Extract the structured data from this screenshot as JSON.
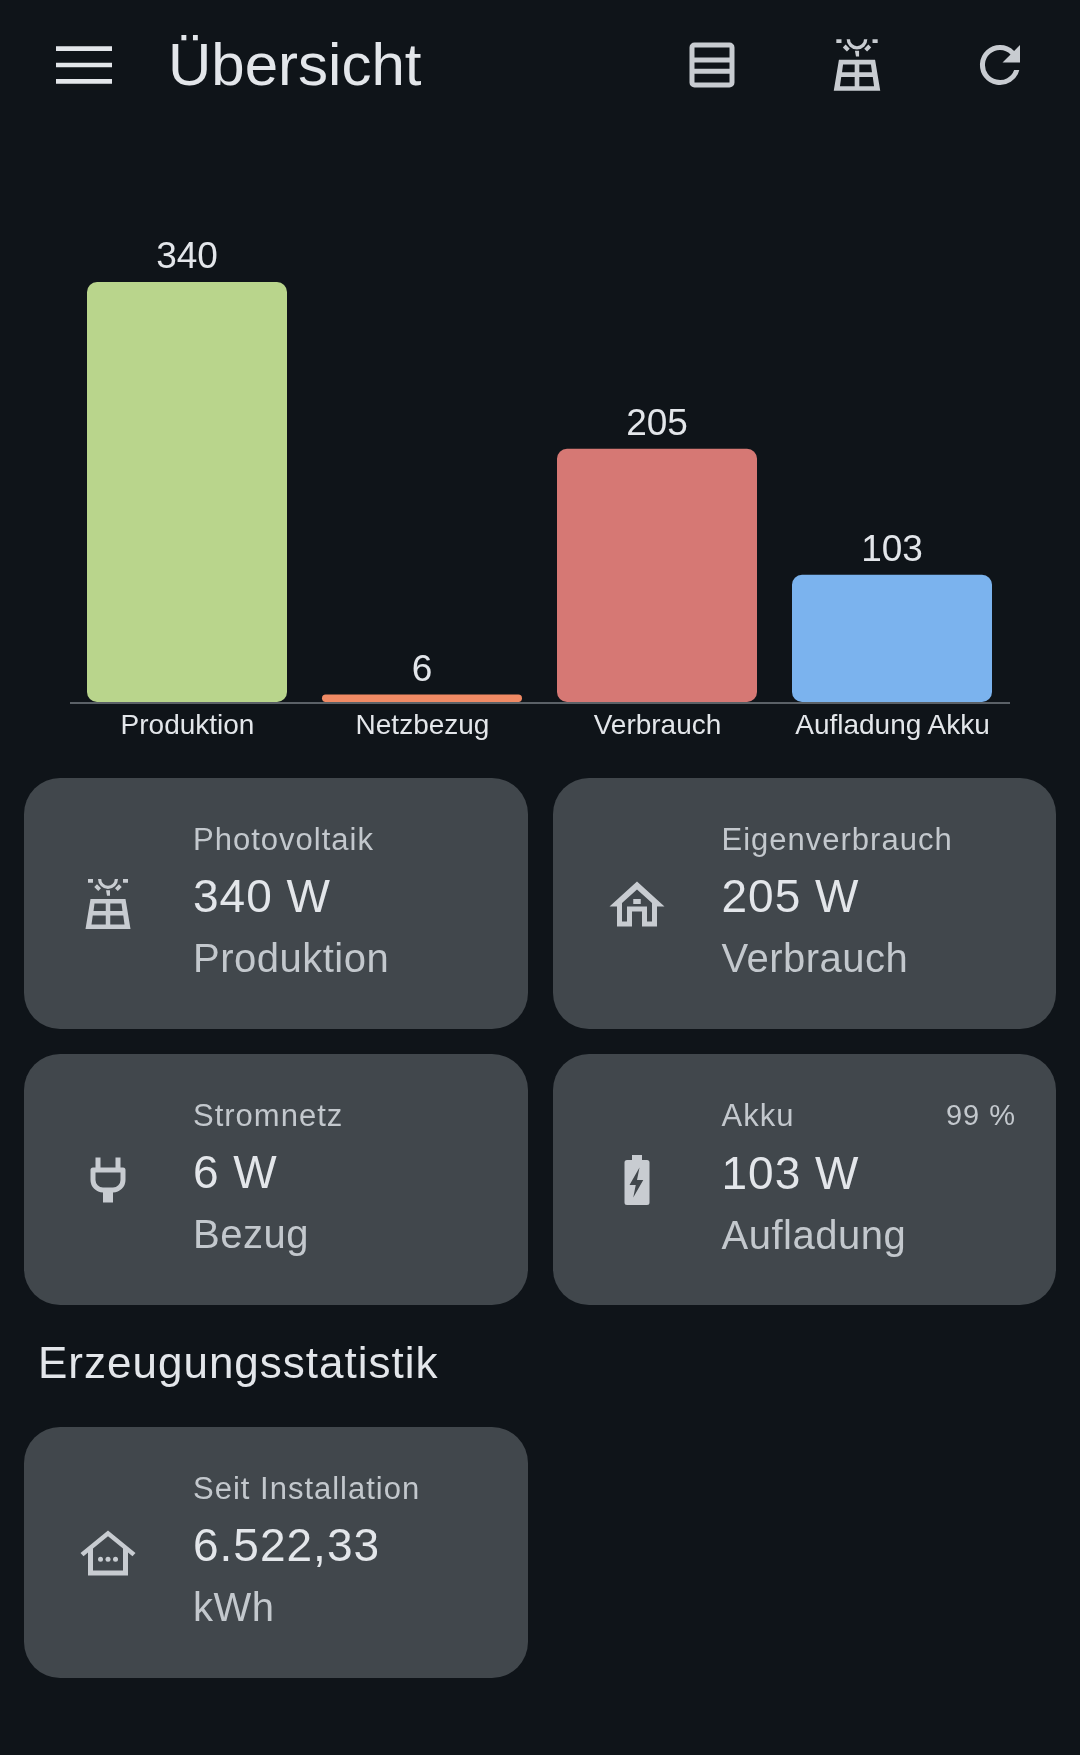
{
  "app_bar": {
    "title": "Übersicht"
  },
  "chart": {
    "chart_data": {
      "type": "bar",
      "categories": [
        "Produktion",
        "Netzbezug",
        "Verbrauch",
        "Aufladung Akku"
      ],
      "data_labels": true,
      "values": [
        340,
        6,
        205,
        103
      ],
      "colors": [
        "#b9d58c",
        "#f08a64",
        "#d67874",
        "#7bb3ee"
      ]
    }
  },
  "cards": [
    {
      "kind": "solar",
      "title": "Photovoltaik",
      "value": "340 W",
      "subtitle": "Produktion"
    },
    {
      "kind": "home",
      "title": "Eigenverbrauch",
      "value": "205 W",
      "subtitle": "Verbrauch"
    },
    {
      "kind": "plug",
      "title": "Stromnetz",
      "value": "6 W",
      "subtitle": "Bezug"
    },
    {
      "kind": "battery",
      "title": "Akku",
      "badge": "99 %",
      "value": "103 W",
      "subtitle": "Aufladung"
    }
  ],
  "section_title": "Erzeugungsstatistik",
  "stats": [
    {
      "kind": "house_dots",
      "title": "Seit Installation",
      "value": "6.522,33",
      "subtitle": "kWh"
    }
  ]
}
